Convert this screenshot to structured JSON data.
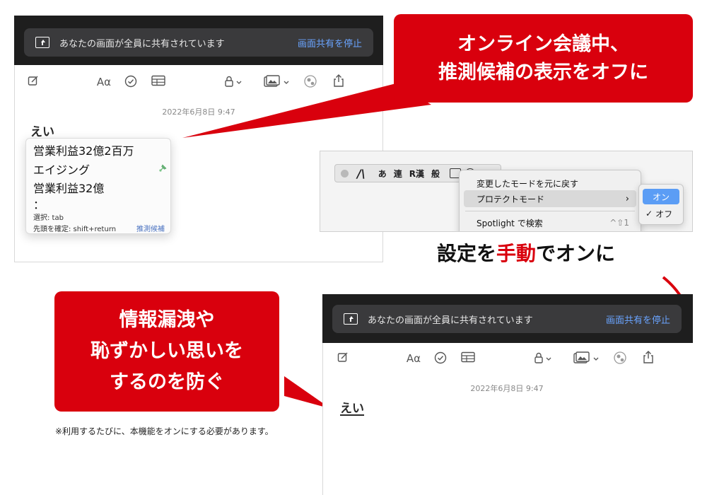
{
  "share_bar": {
    "message": "あなたの画面が全員に共有されています",
    "stop_label": "画面共有を停止"
  },
  "toolbar": {
    "font_label": "Aα"
  },
  "note": {
    "date": "2022年6月8日 9:47",
    "typed_word": "えい"
  },
  "candidates": {
    "items": [
      "営業利益32億2百万",
      "エイジング",
      "営業利益32億",
      "："
    ],
    "select_hint": "選択: tab",
    "confirm_hint": "先頭を確定: shift+return",
    "predict_label": "推測候補"
  },
  "callout_top": {
    "line1": "オンライン会議中、",
    "line2": "推測候補の表示をオフに"
  },
  "callout_bottom": {
    "line1": "情報漏洩や",
    "line2": "恥ずかしい思いを",
    "line3": "するのを防ぐ"
  },
  "ime_menu": {
    "bar_chars": [
      "あ",
      "連",
      "R漢",
      "般"
    ],
    "undo_mode": "変更したモードを元に戻す",
    "protect_mode": "プロテクトモード",
    "spotlight": "Spotlight で検索",
    "spotlight_shortcut": "^⇧1",
    "on_label": "オン",
    "off_label": "オフ",
    "check_mark": "✓",
    "accent_color": "#5b9df5"
  },
  "manual_label": {
    "prefix": "設定を",
    "emphasis": "手動",
    "suffix": "でオンに"
  },
  "footnote": "※利用するたびに、本機能をオンにする必要があります。",
  "colors": {
    "callout_red": "#d9000d",
    "link_blue": "#6aa4ff"
  }
}
